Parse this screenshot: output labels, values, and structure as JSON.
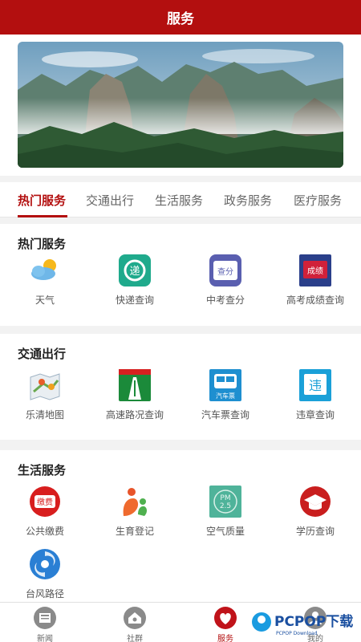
{
  "header": {
    "title": "服务"
  },
  "tabs": [
    {
      "label": "热门服务",
      "active": true
    },
    {
      "label": "交通出行",
      "active": false
    },
    {
      "label": "生活服务",
      "active": false
    },
    {
      "label": "政务服务",
      "active": false
    },
    {
      "label": "医疗服务",
      "active": false
    }
  ],
  "sections": [
    {
      "title": "热门服务",
      "items": [
        {
          "label": "天气",
          "icon": "weather-icon"
        },
        {
          "label": "快递查询",
          "icon": "express-icon"
        },
        {
          "label": "中考查分",
          "icon": "exam-score-icon"
        },
        {
          "label": "高考成绩查询",
          "icon": "gaokao-icon"
        }
      ]
    },
    {
      "title": "交通出行",
      "items": [
        {
          "label": "乐清地图",
          "icon": "map-icon"
        },
        {
          "label": "高速路况查询",
          "icon": "highway-icon"
        },
        {
          "label": "汽车票查询",
          "icon": "bus-ticket-icon"
        },
        {
          "label": "违章查询",
          "icon": "violation-icon"
        }
      ]
    },
    {
      "title": "生活服务",
      "items": [
        {
          "label": "公共缴费",
          "icon": "payment-icon"
        },
        {
          "label": "生育登记",
          "icon": "birth-icon"
        },
        {
          "label": "空气质量",
          "icon": "air-quality-icon"
        },
        {
          "label": "学历查询",
          "icon": "education-icon"
        },
        {
          "label": "台风路径",
          "icon": "typhoon-icon"
        }
      ]
    }
  ],
  "icon_text": {
    "express": "递",
    "exam": "查分",
    "gaokao": "成绩",
    "pm_top": "PM",
    "pm_bottom": "2.5",
    "pay": "缴费",
    "violation": "违",
    "bus": "汽车票"
  },
  "bottom_nav": [
    {
      "label": "新闻",
      "icon": "news-icon",
      "active": false
    },
    {
      "label": "社群",
      "icon": "community-icon",
      "active": false
    },
    {
      "label": "服务",
      "icon": "service-icon",
      "active": true
    },
    {
      "label": "我的",
      "icon": "profile-icon",
      "active": false
    }
  ],
  "watermark": {
    "brand": "PCPOP下载",
    "sub": "PCPOP Download"
  },
  "colors": {
    "brand": "#b30f0f",
    "background": "#f2f2f2"
  }
}
